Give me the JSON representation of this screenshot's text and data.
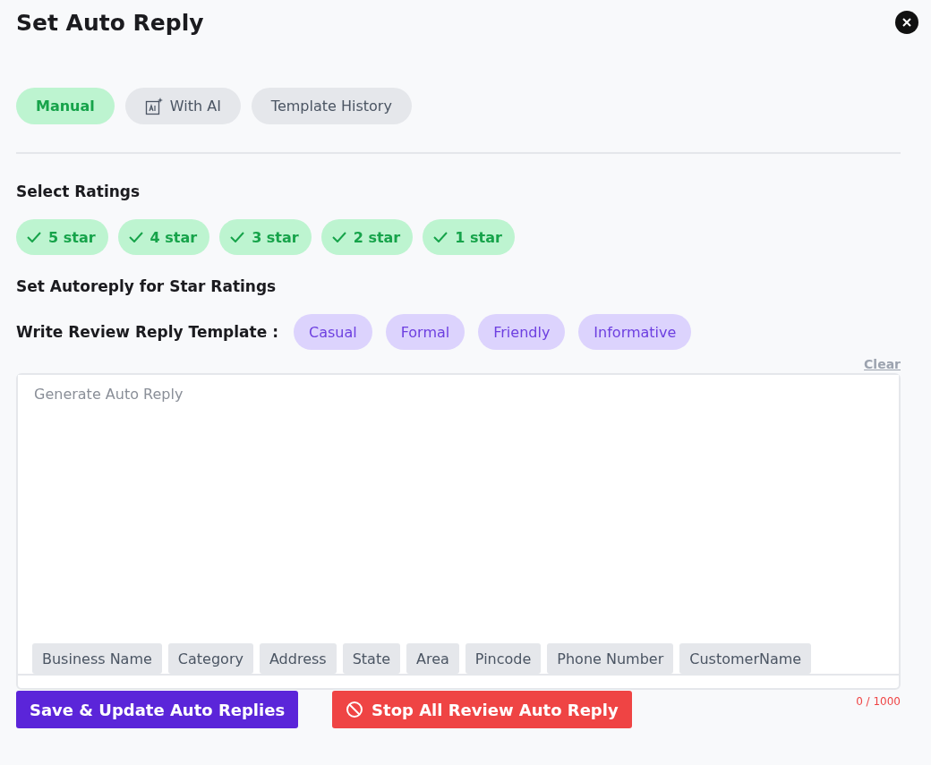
{
  "title": "Set Auto Reply",
  "tabs": [
    {
      "label": "Manual",
      "selected": true,
      "kind": "plain"
    },
    {
      "label": "With AI",
      "selected": false,
      "kind": "ai"
    },
    {
      "label": "Template History",
      "selected": false,
      "kind": "plain"
    }
  ],
  "ratings": {
    "heading": "Select Ratings",
    "items": [
      {
        "label": "5 star",
        "checked": true
      },
      {
        "label": "4 star",
        "checked": true
      },
      {
        "label": "3 star",
        "checked": true
      },
      {
        "label": "2 star",
        "checked": true
      },
      {
        "label": "1 star",
        "checked": true
      }
    ]
  },
  "autoreply_heading": "Set Autoreply for Star Ratings",
  "template": {
    "label": "Write Review Reply Template :",
    "tones": [
      "Casual",
      "Formal",
      "Friendly",
      "Informative"
    ]
  },
  "clear": "Clear",
  "editor": {
    "placeholder": "Generate Auto Reply",
    "variables": [
      "Business Name",
      "Category",
      "Address",
      "State",
      "Area",
      "Pincode",
      "Phone Number",
      "CustomerName"
    ]
  },
  "counter": "0 / 1000",
  "buttons": {
    "save": "Save & Update Auto Replies",
    "stop": "Stop All Review Auto Reply"
  }
}
